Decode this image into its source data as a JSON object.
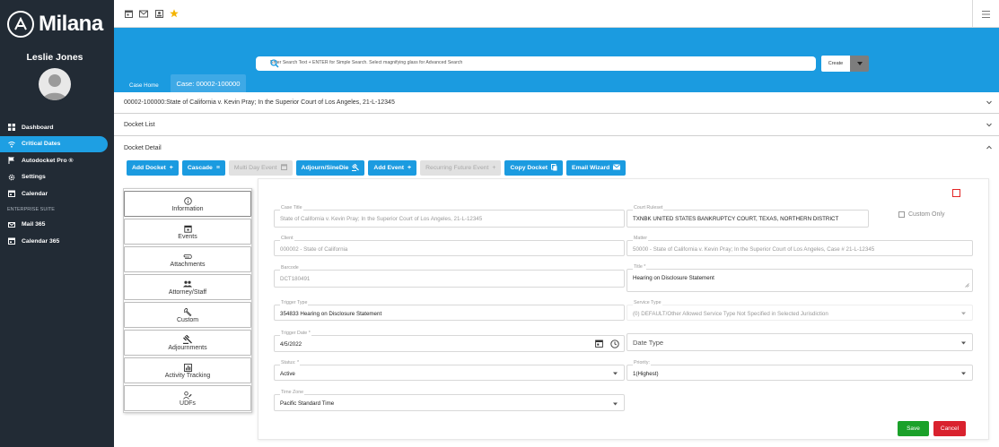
{
  "sidebar": {
    "logo_text": "Milana",
    "user_name": "Leslie Jones",
    "items": [
      {
        "label": "Dashboard",
        "icon": "dashboard-icon"
      },
      {
        "label": "Critical Dates",
        "icon": "wifi-icon",
        "active": true
      },
      {
        "label": "Autodocket Pro ®",
        "icon": "docket-icon"
      },
      {
        "label": "Settings",
        "icon": "gear-icon"
      },
      {
        "label": "Calendar",
        "icon": "calendar-icon"
      }
    ],
    "section_label": "ENTERPRISE SUITE",
    "enterprise_items": [
      {
        "label": "Mail 365",
        "icon": "mail-icon"
      },
      {
        "label": "Calendar 365",
        "icon": "calendar-icon"
      }
    ]
  },
  "search": {
    "placeholder": "Enter Search Text + ENTER for Simple Search. Select magnifying glass for Advanced Search"
  },
  "create_label": "Create",
  "tabs": [
    {
      "label": "Case Home"
    },
    {
      "label": "Case: 00002-100000",
      "active": true
    }
  ],
  "case_header": "00002-100000:State of California v. Kevin Pray; In the Superior Court of Los Angeles, 21-L-12345",
  "docket_list_label": "Docket List",
  "docket_detail_label": "Docket Detail",
  "toolbar": {
    "add_docket": "Add Docket",
    "cascade": "Cascade",
    "multi_day_event": "Multi Day Event",
    "adjourn_sinedie": "Adjourn/SineDie",
    "add_event": "Add Event",
    "recurring_future_event": "Recurring Future Event",
    "copy_docket": "Copy Docket",
    "email_wizard": "Email Wizard"
  },
  "left_nav": [
    {
      "label": "Information",
      "icon": "info-icon"
    },
    {
      "label": "Events",
      "icon": "calendar-icon"
    },
    {
      "label": "Attachments",
      "icon": "paperclip-icon"
    },
    {
      "label": "Attorney/Staff",
      "icon": "people-icon"
    },
    {
      "label": "Custom",
      "icon": "wrench-icon"
    },
    {
      "label": "Adjournments",
      "icon": "gavel-icon"
    },
    {
      "label": "Activity Tracking",
      "icon": "chart-icon"
    },
    {
      "label": "UDFs",
      "icon": "user-edit-icon"
    }
  ],
  "form": {
    "case_title": {
      "label": "Case Title",
      "value": "State of California v. Kevin Pray; In the Superior Court of Los Angeles, 21-L-12345"
    },
    "court_ruleset": {
      "label": "Court Ruleset",
      "value": "TXNBK UNITED STATES BANKRUPTCY COURT, TEXAS, NORTHERN DISTRICT"
    },
    "custom_only": "Custom Only",
    "client": {
      "label": "Client",
      "value": "000002 - State of California"
    },
    "matter": {
      "label": "Matter",
      "value": "50000 - State of California v. Kevin Pray; In the Superior Court of Los Angeles, Case # 21-L-12345"
    },
    "barcode": {
      "label": "Barcode",
      "value": "DCT180491"
    },
    "title": {
      "label": "Title *",
      "value": "Hearing on Disclosure Statement"
    },
    "trigger_type": {
      "label": "Trigger Type",
      "value": "354833 Hearing on Disclosure Statement"
    },
    "service_type": {
      "label": "Service Type",
      "value": "(0) DEFAULT/Other Allowed Service Type Not Specified in Selected Jurisdiction"
    },
    "trigger_date": {
      "label": "Trigger Date *",
      "value": "4/5/2022"
    },
    "date_type": {
      "placeholder": "Date Type"
    },
    "status": {
      "label": "Status: *",
      "value": "Active"
    },
    "priority": {
      "label": "Priority:",
      "value": "1(Highest)"
    },
    "time_zone": {
      "label": "Time Zone",
      "value": "Pacific Standard Time"
    },
    "save": "Save",
    "cancel": "Cancel"
  }
}
